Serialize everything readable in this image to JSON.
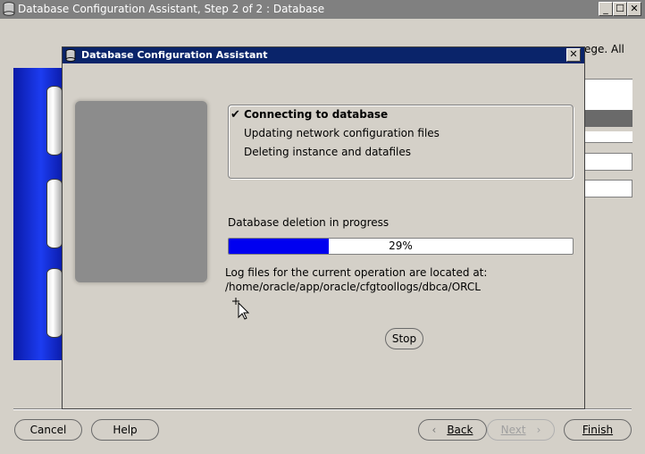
{
  "main_window": {
    "title": "Database Configuration Assistant, Step 2 of 2 : Database",
    "controls": {
      "minimize": "_",
      "maximize": "☐",
      "close": "✕"
    },
    "background_text_partial": "ege. All"
  },
  "dialog": {
    "title": "Database Configuration Assistant",
    "close_glyph": "✕",
    "steps": [
      {
        "label": "Connecting to database",
        "status": "done",
        "check": "✔"
      },
      {
        "label": "Updating network configuration files",
        "status": "pending"
      },
      {
        "label": "Deleting instance and datafiles",
        "status": "pending"
      }
    ],
    "progress": {
      "label": "Database deletion in progress",
      "percent_text": "29%",
      "value": 0.29,
      "fill_color": "#0000f0"
    },
    "log": {
      "line1": "Log files for the current operation are located at:",
      "line2": "/home/oracle/app/oracle/cfgtoollogs/dbca/ORCL"
    },
    "stop_label": "Stop"
  },
  "footer": {
    "cancel": "Cancel",
    "help": "Help",
    "back": "Back",
    "next": "Next",
    "finish": "Finish"
  },
  "colors": {
    "dialog_title_bg": "#0a246a",
    "window_bg": "#d4d0c8",
    "side_panel": "#1c3cf0"
  }
}
